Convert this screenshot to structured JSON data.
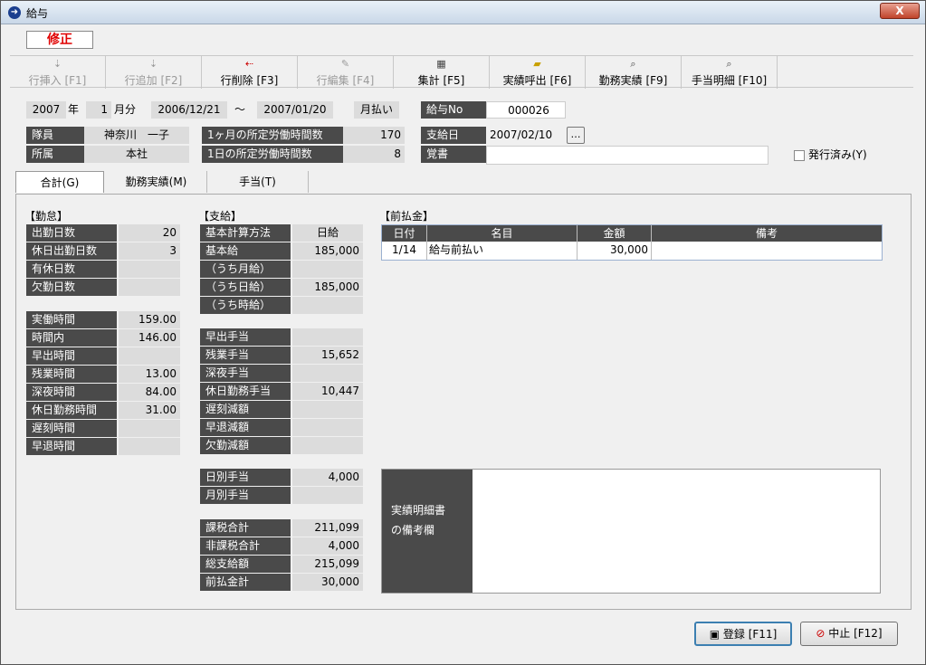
{
  "window": {
    "title": "給与",
    "close_label": "X"
  },
  "mode_badge": "修正",
  "toolbar": [
    {
      "label": "行挿入 [F1]",
      "icon": "insert-row-icon",
      "enabled": false
    },
    {
      "label": "行追加 [F2]",
      "icon": "add-row-icon",
      "enabled": false
    },
    {
      "label": "行削除 [F3]",
      "icon": "delete-row-icon",
      "enabled": true
    },
    {
      "label": "行編集 [F4]",
      "icon": "edit-row-icon",
      "enabled": false
    },
    {
      "label": "集計 [F5]",
      "icon": "tally-icon",
      "enabled": true
    },
    {
      "label": "実績呼出 [F6]",
      "icon": "folder-open-icon",
      "enabled": true
    },
    {
      "label": "勤務実績 [F9]",
      "icon": "preview-icon",
      "enabled": true
    },
    {
      "label": "手当明細 [F10]",
      "icon": "preview-icon",
      "enabled": true
    }
  ],
  "header": {
    "year": "2007",
    "year_unit": "年",
    "month": "1",
    "month_unit": "月分",
    "period_from": "2006/12/21",
    "tilde": "〜",
    "period_to": "2007/01/20",
    "payment_type": "月払い",
    "salary_no_label": "給与No",
    "salary_no": "000026",
    "member_label": "隊員",
    "member": "神奈川　一子",
    "dept_label": "所属",
    "dept": "本社",
    "monthly_hours_label": "1ヶ月の所定労働時間数",
    "monthly_hours": "170",
    "daily_hours_label": "1日の所定労働時間数",
    "daily_hours": "8",
    "pay_date_label": "支給日",
    "pay_date": "2007/02/10",
    "ellipsis": "…",
    "memo_label": "覚書",
    "memo": "",
    "issued_label": "発行済み(Y)"
  },
  "tabs": [
    "合計(G)",
    "勤務実績(M)",
    "手当(T)"
  ],
  "attendance": {
    "title": "【勤怠】",
    "rows": [
      {
        "label": "出勤日数",
        "value": "20"
      },
      {
        "label": "休日出勤日数",
        "value": "3"
      },
      {
        "label": "有休日数",
        "value": ""
      },
      {
        "label": "欠勤日数",
        "value": ""
      }
    ],
    "time_rows": [
      {
        "label": "実働時間",
        "value": "159.00"
      },
      {
        "label": "時間内",
        "value": "146.00"
      },
      {
        "label": "早出時間",
        "value": ""
      },
      {
        "label": "残業時間",
        "value": "13.00"
      },
      {
        "label": "深夜時間",
        "value": "84.00"
      },
      {
        "label": "休日勤務時間",
        "value": "31.00"
      },
      {
        "label": "遅刻時間",
        "value": ""
      },
      {
        "label": "早退時間",
        "value": ""
      }
    ]
  },
  "payment": {
    "title": "【支給】",
    "base_rows": [
      {
        "label": "基本計算方法",
        "value": "日給"
      },
      {
        "label": "基本給",
        "value": "185,000"
      },
      {
        "label": "（うち月給）",
        "value": ""
      },
      {
        "label": "（うち日給）",
        "value": "185,000"
      },
      {
        "label": "（うち時給）",
        "value": ""
      }
    ],
    "allowance_rows": [
      {
        "label": "早出手当",
        "value": ""
      },
      {
        "label": "残業手当",
        "value": "15,652"
      },
      {
        "label": "深夜手当",
        "value": ""
      },
      {
        "label": "休日勤務手当",
        "value": "10,447"
      },
      {
        "label": "遅刻減額",
        "value": ""
      },
      {
        "label": "早退減額",
        "value": ""
      },
      {
        "label": "欠勤減額",
        "value": ""
      }
    ],
    "daily_rows": [
      {
        "label": "日別手当",
        "value": "4,000"
      },
      {
        "label": "月別手当",
        "value": ""
      }
    ],
    "total_rows": [
      {
        "label": "課税合計",
        "value": "211,099"
      },
      {
        "label": "非課税合計",
        "value": "4,000"
      },
      {
        "label": "総支給額",
        "value": "215,099"
      },
      {
        "label": "前払金計",
        "value": "30,000"
      }
    ]
  },
  "advance": {
    "title": "【前払金】",
    "columns": [
      "日付",
      "名目",
      "金額",
      "備考"
    ],
    "rows": [
      {
        "date": "1/14",
        "name": "給与前払い",
        "amount": "30,000",
        "note": ""
      }
    ]
  },
  "statement_memo": {
    "label_line1": "実績明細書",
    "label_line2": "の備考欄",
    "value": ""
  },
  "footer": {
    "save_label": "登録 [F11]",
    "cancel_label": "中止 [F12]"
  }
}
